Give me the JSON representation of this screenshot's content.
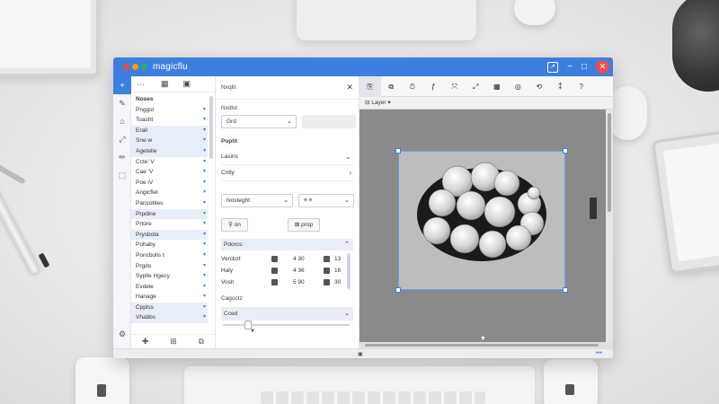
{
  "window": {
    "app_title": "magicflu",
    "traffic_colors": [
      "#e74c3c",
      "#f39c12",
      "#27ae60"
    ],
    "ext_icon": "external-link-icon",
    "min_label": "−",
    "max_label": "□",
    "close_label": "✕"
  },
  "activity_icons": [
    "+",
    "✎",
    "⌂",
    "⤢",
    "✏",
    "⬚",
    "⚙"
  ],
  "sidebar": {
    "head_icons": [
      "···",
      "▦",
      "▣"
    ],
    "items": [
      {
        "label": "Noses",
        "hdr": true,
        "hl": false
      },
      {
        "label": "Pnggst",
        "hl": false
      },
      {
        "label": "Toasht",
        "hl": false
      },
      {
        "label": "Erall",
        "hl": true
      },
      {
        "label": "Sne w",
        "hl": true
      },
      {
        "label": "Agetelle",
        "hl": true
      },
      {
        "label": "Ccte' V",
        "hl": false
      },
      {
        "label": "Cae 'V",
        "hl": false
      },
      {
        "label": "Poe iV",
        "hl": false
      },
      {
        "label": "Angicflel",
        "hl": false
      },
      {
        "label": "Pancobles",
        "hl": false
      },
      {
        "label": "Prpdine",
        "hl": true
      },
      {
        "label": "Prtore",
        "hl": false
      },
      {
        "label": "Prysbota",
        "hl": true
      },
      {
        "label": "Pohaby",
        "hl": false
      },
      {
        "label": "Poncbolis t",
        "hl": false
      },
      {
        "label": "Prgdo",
        "hl": false
      },
      {
        "label": "Syplle Hgecy",
        "hl": false
      },
      {
        "label": "Evdele",
        "hl": false
      },
      {
        "label": "Hanage",
        "hl": false
      },
      {
        "label": "Cpplss",
        "hl": true
      },
      {
        "label": "Vhabbs",
        "hl": true
      }
    ],
    "foot_icons": [
      "✚",
      "⊞",
      "⧉"
    ]
  },
  "props": {
    "title": "Nxqlit",
    "close": "✕",
    "section1_label": "Nxdlst",
    "select1_value": "Grd",
    "section2_label": "Poplit",
    "row_layers": "Lasins",
    "row_ctrl": "Cntly",
    "select2_value": "Nosteght",
    "select3_value": "≡ ≡",
    "btn_on": "on",
    "btn_pro": "prop",
    "section_hd": "Pdorcs:",
    "trows": [
      {
        "label": "Vercbzt",
        "v1": "4  30",
        "v2": "13"
      },
      {
        "label": "Haly",
        "v1": "4  36",
        "v2": "16"
      },
      {
        "label": "Vosh",
        "v1": "5  90",
        "v2": "30"
      }
    ],
    "cap_label": "Cagoctz",
    "cap_select": "Cced",
    "slider_value": 0.2
  },
  "toolbar": {
    "tools": [
      "⎘",
      "⧉",
      "⏱",
      "ƒ",
      "⤧",
      "⤢",
      "▦",
      "◎",
      "⟲",
      "⁑",
      "?"
    ],
    "active_index": 0
  },
  "canvas": {
    "layer_label": "Layer",
    "bg_color": "#8a8a8a",
    "artboard_color": "#bdbdbd"
  },
  "status": {
    "icon": "▣",
    "dots": "•••"
  }
}
